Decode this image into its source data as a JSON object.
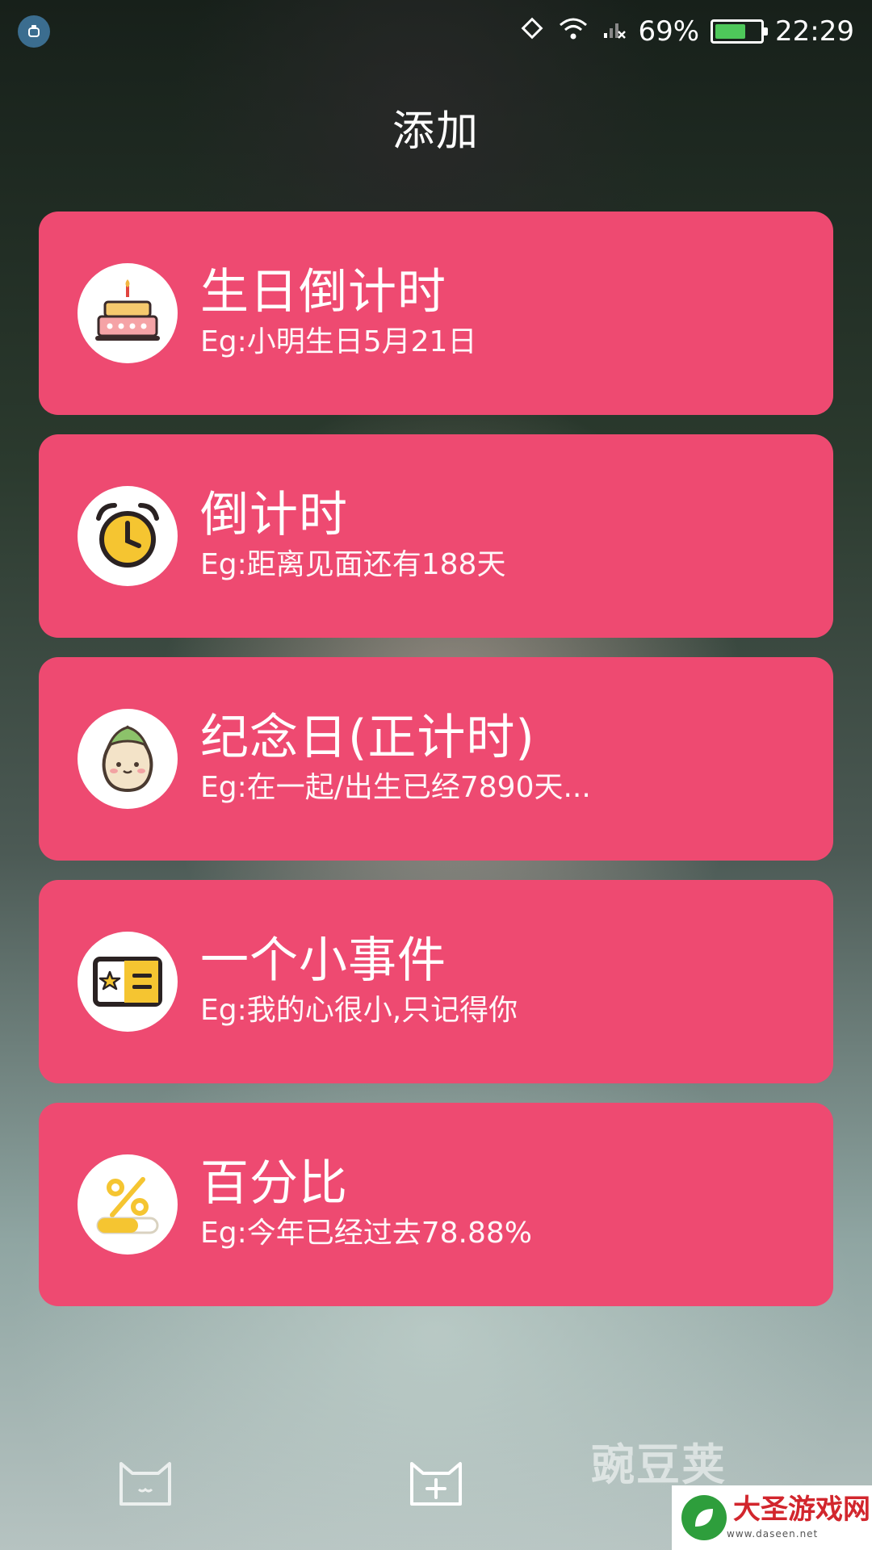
{
  "status": {
    "battery": "69%",
    "time": "22:29",
    "battery_level": 0.69
  },
  "header": {
    "title": "添加"
  },
  "cards": [
    {
      "title": "生日倒计时",
      "subtitle": "Eg:小明生日5月21日",
      "icon": "birthday-cake-icon"
    },
    {
      "title": "倒计时",
      "subtitle": "Eg:距离见面还有188天",
      "icon": "alarm-clock-icon"
    },
    {
      "title": "纪念日(正计时)",
      "subtitle": "Eg:在一起/出生已经7890天...",
      "icon": "sprout-face-icon"
    },
    {
      "title": "一个小事件",
      "subtitle": "Eg:我的心很小,只记得你",
      "icon": "ticket-icon"
    },
    {
      "title": "百分比",
      "subtitle": "Eg:今年已经过去78.88%",
      "icon": "percentage-icon"
    }
  ],
  "nav": {
    "tabs": [
      "cat-face-icon",
      "add-event-icon"
    ]
  },
  "watermark": {
    "ghost_text": "豌豆荚",
    "logo_text": "大圣游戏网",
    "logo_url": "www.daseen.net"
  },
  "colors": {
    "card": "#ee4a71",
    "text": "#ffffff"
  }
}
